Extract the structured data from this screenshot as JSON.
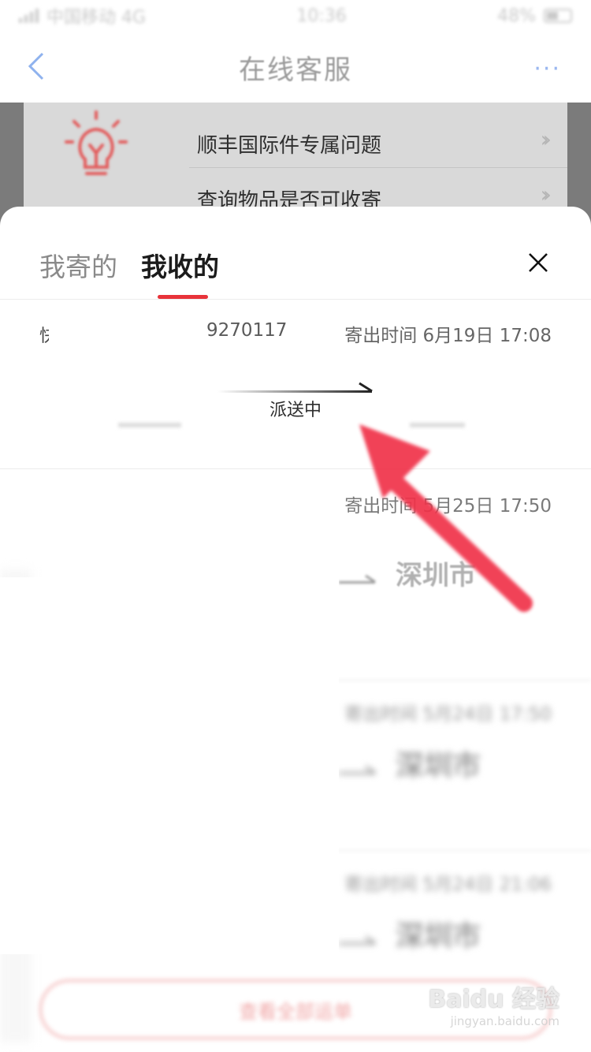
{
  "status_bar": {
    "carrier": "中国移动 4G",
    "time": "10:36",
    "battery": "48%"
  },
  "nav": {
    "title": "在线客服"
  },
  "background": {
    "rows": [
      {
        "label": "顺丰国际件专属问题"
      },
      {
        "label": "查询物品是否可收寄"
      }
    ]
  },
  "sheet": {
    "tabs": [
      {
        "label": "我寄的",
        "active": false
      },
      {
        "label": "我收的",
        "active": true
      }
    ],
    "records": [
      {
        "mark": "快",
        "number_fragment": "9270117",
        "send_time": "寄出时间 6月19日 17:08",
        "status": "派送中"
      },
      {
        "send_time": "寄出时间 5月25日 17:50",
        "destination": "深圳市"
      },
      {
        "send_time": "寄出时间 5月24日 17:50",
        "destination": "深圳市"
      },
      {
        "send_time": "寄出时间 5月24日 21:06",
        "destination": "深圳市"
      }
    ],
    "bottom_button": "查看全部运单"
  },
  "watermark": {
    "logo": "Baidu 经验",
    "url": "jingyan.baidu.com"
  },
  "colors": {
    "accent": "#e8333a",
    "annotation": "#f0334a",
    "nav_more": "#9ab7f0"
  }
}
